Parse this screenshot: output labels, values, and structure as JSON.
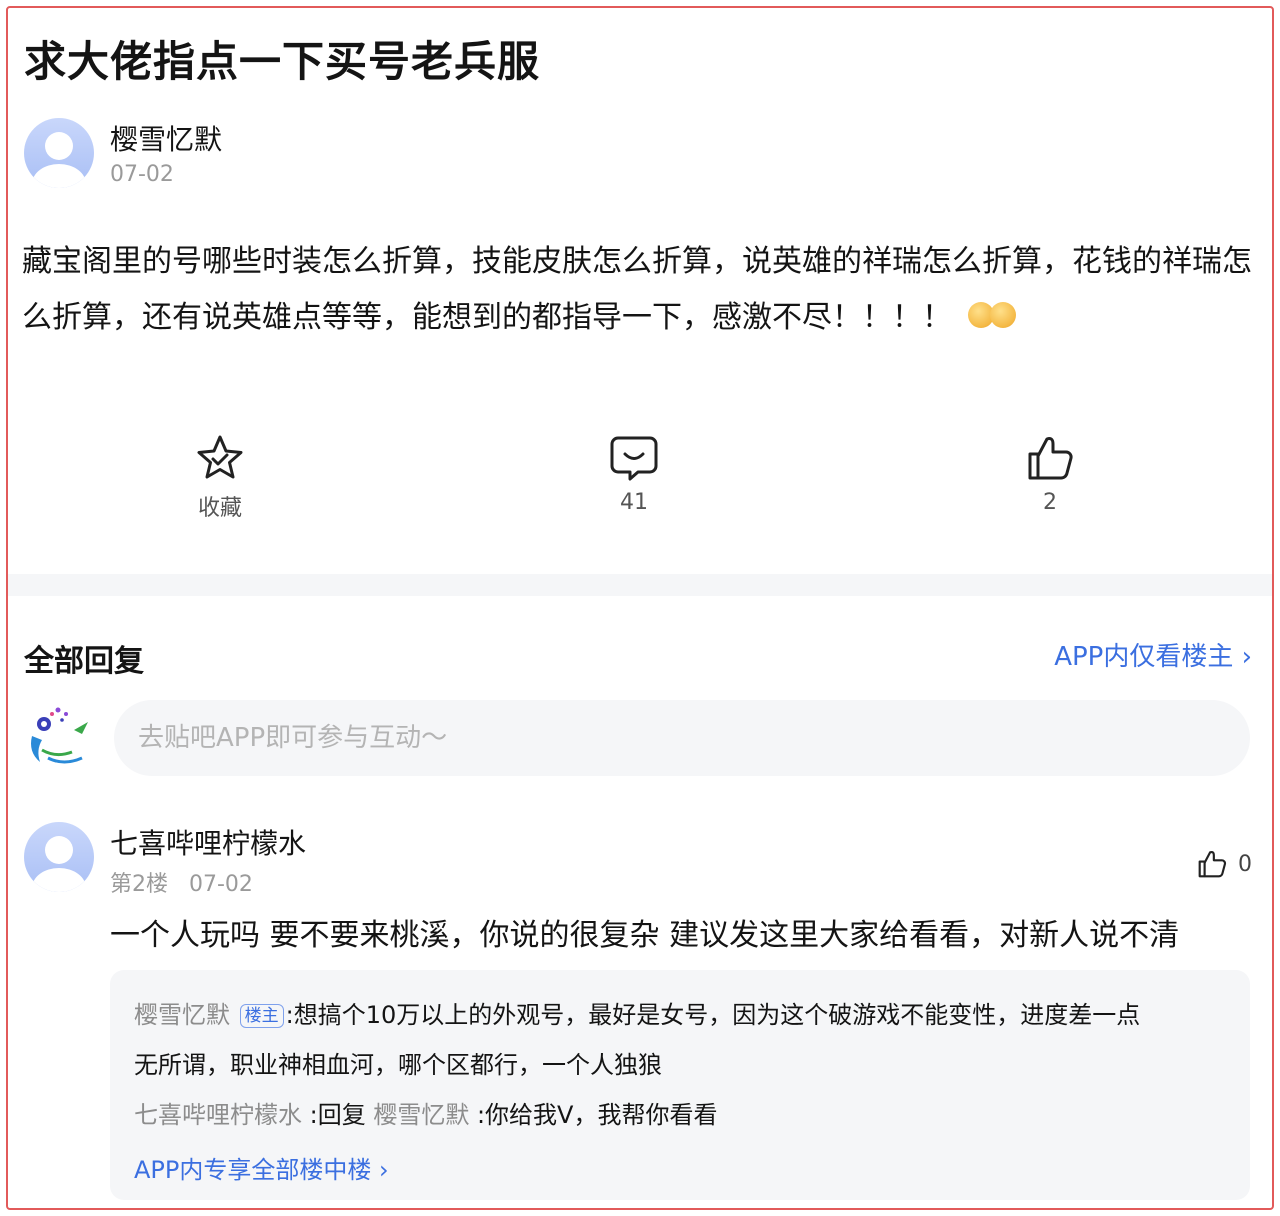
{
  "post": {
    "title": "求大佬指点一下买号老兵服",
    "author": "樱雪忆默",
    "date": "07-02",
    "body": "藏宝阁里的号哪些时装怎么折算，技能皮肤怎么折算，说英雄的祥瑞怎么折算，花钱的祥瑞怎么折算，还有说英雄点等等，能想到的都指导一下，感激不尽！！！！"
  },
  "actions": {
    "favorite_label": "收藏",
    "comment_count": "41",
    "like_count": "2",
    "icons": [
      "star-icon",
      "comment-icon",
      "thumbs-up-icon"
    ]
  },
  "replies": {
    "section_title": "全部回复",
    "app_only_host": "APP内仅看楼主 ›",
    "input_placeholder": "去贴吧APP即可参与互动～"
  },
  "comment": {
    "author": "七喜哔哩柠檬水",
    "floor": "第2楼",
    "date": "07-02",
    "like_count": "0",
    "text": "一个人玩吗 要不要来桃溪，你说的很复杂 建议发这里大家给看看，对新人说不清",
    "sub_replies": [
      {
        "author": "樱雪忆默",
        "badge": "楼主",
        "text": ":想搞个10万以上的外观号，最好是女号，因为这个破游戏不能变性，进度差一点",
        "text_cont": "无所谓，职业神相血河，哪个区都行，一个人独狼"
      },
      {
        "author": "七喜哔哩柠檬水",
        "reply_word": " :回复 ",
        "reply_to": "樱雪忆默",
        "text": " :你给我V，我帮你看看"
      }
    ],
    "more_link": "APP内专享全部楼中楼 ›"
  },
  "colors": {
    "accent": "#3b6fe0",
    "border": "#e25a5a",
    "muted": "#9a9a9a",
    "panel": "#f5f6f8"
  }
}
